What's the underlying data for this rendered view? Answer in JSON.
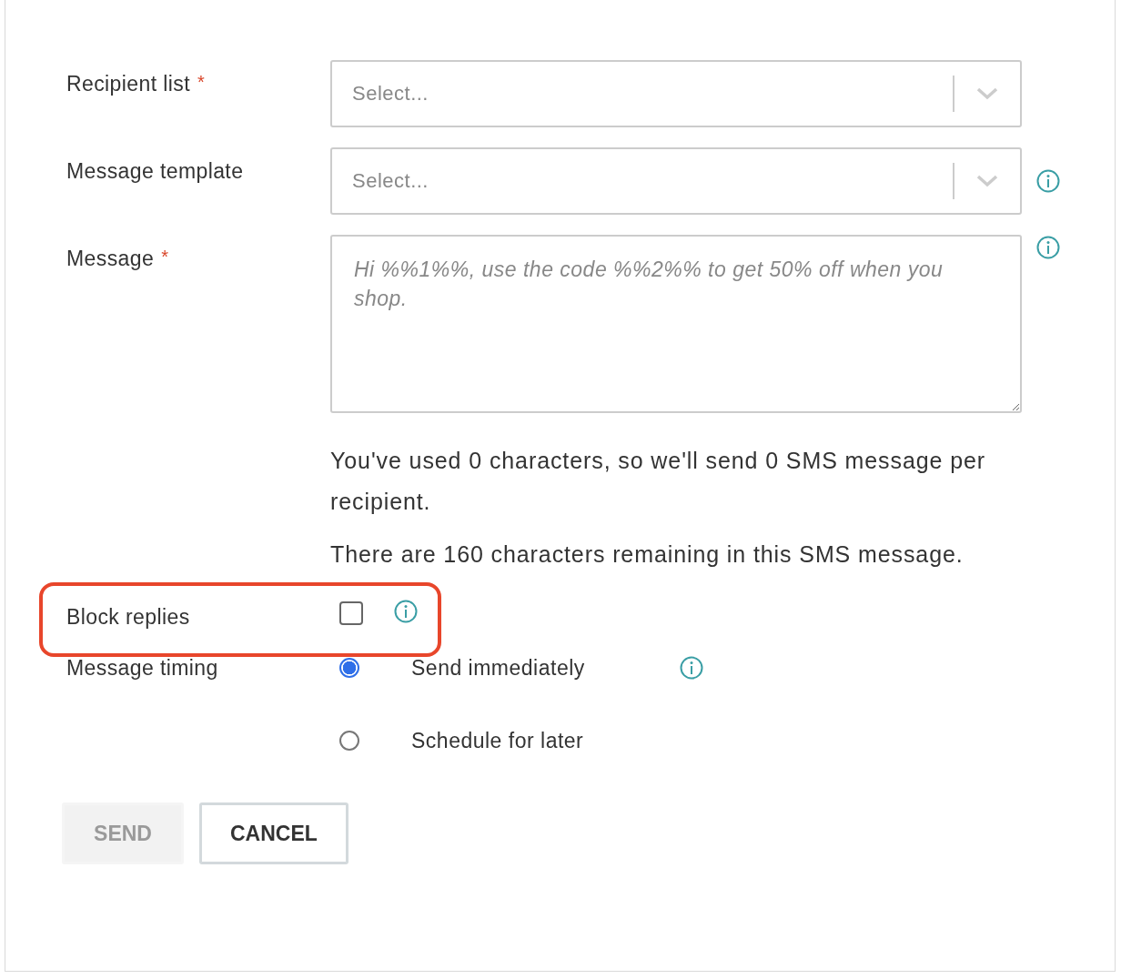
{
  "fields": [
    {
      "kind": "select",
      "label": "Recipient list",
      "required_mark": "*",
      "placeholder": "Select...",
      "info": false
    },
    {
      "kind": "select",
      "label": "Message template",
      "placeholder": "Select...",
      "info": true
    },
    {
      "kind": "textarea",
      "label": "Message",
      "required_mark": "*",
      "placeholder": "Hi %%1%%, use the code %%2%% to get 50% off when you shop.",
      "info": true
    }
  ],
  "help_texts": [
    "You've used 0 characters, so we'll send 0 SMS message per recipient.",
    "There are 160 characters remaining in this SMS message."
  ],
  "block_replies": {
    "label": "Block replies",
    "checked": false,
    "info": true,
    "highlighted": true
  },
  "message_timing": {
    "label": "Message timing",
    "options": [
      {
        "label": "Send immediately",
        "selected": true,
        "info": true
      },
      {
        "label": "Schedule for later",
        "selected": false,
        "info": false
      }
    ]
  },
  "buttons": [
    {
      "label": "SEND",
      "disabled": true
    },
    {
      "label": "CANCEL",
      "disabled": false
    }
  ]
}
